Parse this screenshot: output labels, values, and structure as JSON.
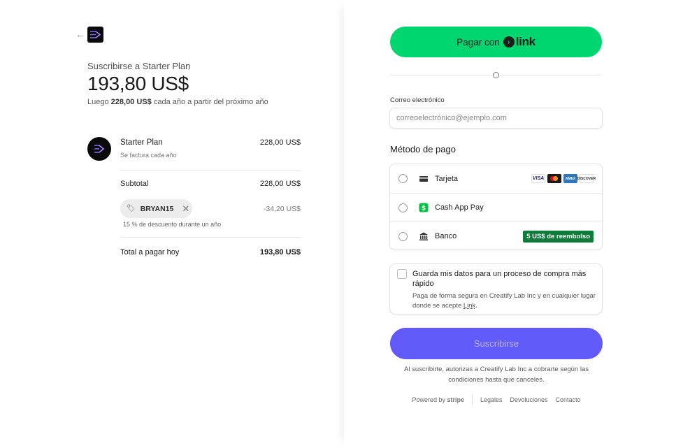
{
  "summary": {
    "subscribe_title": "Suscribirse a Starter Plan",
    "price": "193,80 US$",
    "note_prefix": "Luego",
    "note_amount": "228,00 US$",
    "note_suffix": "cada año a partir del próximo año"
  },
  "line_item": {
    "name": "Starter Plan",
    "billing": "Se factura cada año",
    "price": "228,00 US$"
  },
  "subtotal": {
    "label": "Subtotal",
    "value": "228,00 US$"
  },
  "promo": {
    "code": "BRYAN15",
    "discount": "-34,20 US$",
    "description": "15 % de descuento durante un año"
  },
  "total": {
    "label": "Total a pagar hoy",
    "value": "193,80 US$"
  },
  "link_button": {
    "label": "Pagar con",
    "brand": "link"
  },
  "email": {
    "label": "Correo electrónico",
    "placeholder": "correoelectrónico@ejemplo.com"
  },
  "payment": {
    "title": "Método de pago",
    "methods": [
      {
        "label": "Tarjeta",
        "icon": "card-icon",
        "card_brands": [
          "VISA",
          "MC",
          "AMEX",
          "DISCOVER"
        ]
      },
      {
        "label": "Cash App Pay",
        "icon": "cash-app-icon"
      },
      {
        "label": "Banco",
        "icon": "bank-icon",
        "badge": "5 US$ de reembolso"
      }
    ]
  },
  "save": {
    "title": "Guarda mis datos para un proceso de compra más rápido",
    "desc_prefix": "Paga de forma segura en Creatify Lab Inc y en cualquier lugar donde se acepte",
    "desc_link": "Link",
    "desc_suffix": "."
  },
  "subscribe_button": "Suscribirse",
  "terms": "Al suscribirte, autorizas a Creatify Lab Inc a cobrarte según las condiciones hasta que canceles.",
  "footer": {
    "powered_prefix": "Powered by",
    "powered_brand": "stripe",
    "links": [
      "Legales",
      "Devoluciones",
      "Contacto"
    ]
  },
  "colors": {
    "link_green": "#00d66f",
    "subscribe_purple": "#625afa",
    "cashback_green": "#0f7b3b"
  }
}
